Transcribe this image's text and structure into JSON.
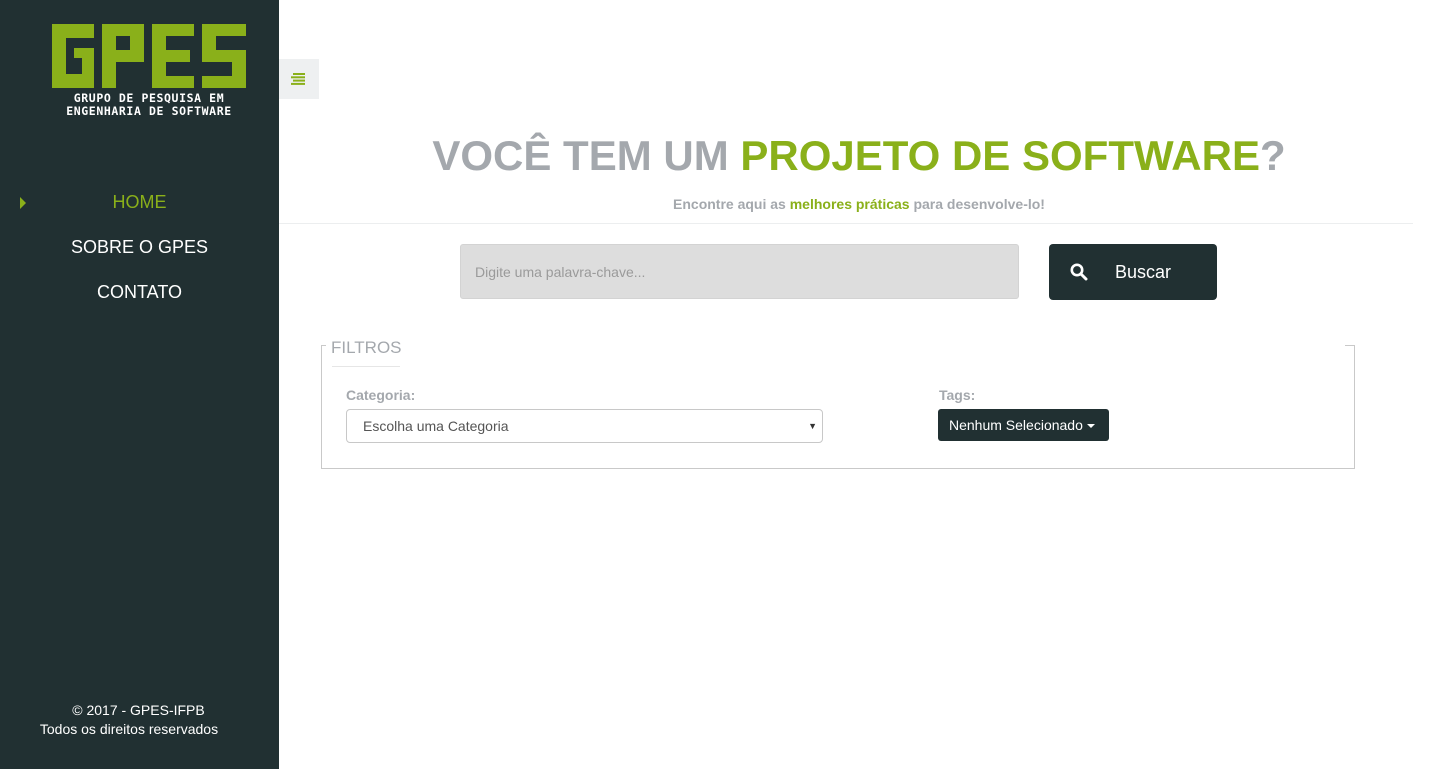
{
  "sidebar": {
    "logo": {
      "mark_text": "GPES",
      "subtitle_line1": "GRUPO DE PESQUISA EM",
      "subtitle_line2": "ENGENHARIA DE SOFTWARE"
    },
    "nav": [
      {
        "label": "HOME",
        "active": true
      },
      {
        "label": "SOBRE O GPES",
        "active": false
      },
      {
        "label": "CONTATO",
        "active": false
      }
    ],
    "footer": {
      "line1": "© 2017 - GPES-IFPB",
      "line2": "Todos os direitos reservados"
    }
  },
  "toggle": {
    "icon": "menu-lines-icon"
  },
  "hero": {
    "title_part1": "VOCÊ TEM UM ",
    "title_accent": "PROJETO DE SOFTWARE",
    "title_part2": "?",
    "subtitle_part1": "Encontre aqui as ",
    "subtitle_accent": "melhores práticas",
    "subtitle_part2": " para desenvolve-lo!"
  },
  "search": {
    "placeholder": "Digite uma palavra-chave...",
    "value": "",
    "button_label": "Buscar",
    "button_icon": "search-icon"
  },
  "filters": {
    "legend": "FILTROS",
    "category_label": "Categoria:",
    "category_selected": "Escolha uma Categoria",
    "tags_label": "Tags:",
    "tags_selected": "Nenhum Selecionado"
  },
  "colors": {
    "sidebar_bg": "#213032",
    "accent": "#8ab01a",
    "muted_text": "#a4a8ad",
    "search_bg": "#dddddd"
  }
}
